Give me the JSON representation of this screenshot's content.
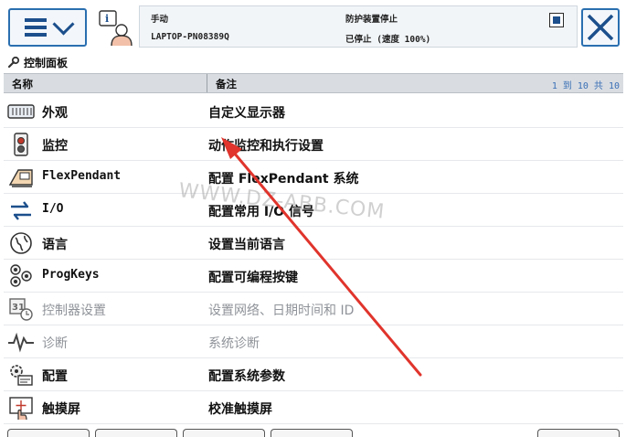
{
  "status": {
    "mode": "手动",
    "controller": "LAPTOP-PN08389Q",
    "state": "防护装置停止",
    "run": "已停止 (速度 100%)"
  },
  "title": "控制面板",
  "columns": {
    "name": "名称",
    "note": "备注"
  },
  "pagination": "1 到 10 共 10",
  "items": [
    {
      "name": "外观",
      "desc": "自定义显示器",
      "icon": "appearance-icon",
      "disabled": false
    },
    {
      "name": "监控",
      "desc": "动作监控和执行设置",
      "icon": "supervision-icon",
      "disabled": false
    },
    {
      "name": "FlexPendant",
      "desc": "配置 FlexPendant 系统",
      "icon": "flexpendant-icon",
      "disabled": false
    },
    {
      "name": "I/O",
      "desc": "配置常用 I/O 信号",
      "icon": "io-icon",
      "disabled": false
    },
    {
      "name": "语言",
      "desc": "设置当前语言",
      "icon": "language-icon",
      "disabled": false
    },
    {
      "name": "ProgKeys",
      "desc": "配置可编程按键",
      "icon": "progkeys-icon",
      "disabled": false
    },
    {
      "name": "控制器设置",
      "desc": "设置网络、日期时间和 ID",
      "icon": "controller-settings-icon",
      "disabled": true
    },
    {
      "name": "诊断",
      "desc": "系统诊断",
      "icon": "diagnostics-icon",
      "disabled": true
    },
    {
      "name": "配置",
      "desc": "配置系统参数",
      "icon": "configuration-icon",
      "disabled": false
    },
    {
      "name": "触摸屏",
      "desc": "校准触摸屏",
      "icon": "touchscreen-icon",
      "disabled": false
    }
  ],
  "watermark": "WWW.DZ-ABB.COM",
  "colors": {
    "accent": "#2a6fb0",
    "arrow": "#e0342c",
    "header": "#d9dde2"
  }
}
